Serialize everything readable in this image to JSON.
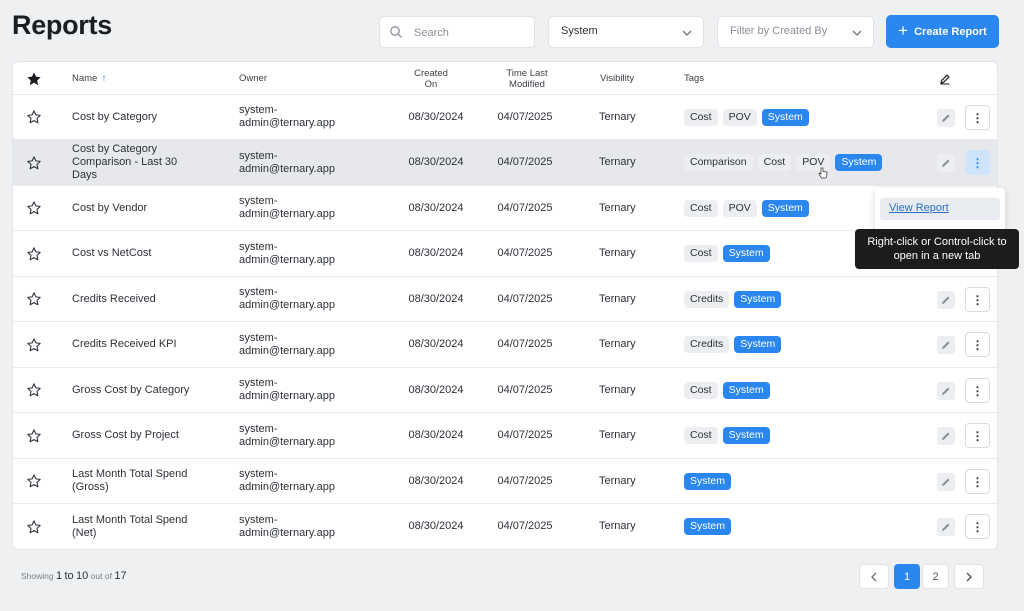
{
  "header": {
    "title": "Reports",
    "search_placeholder": "Search",
    "visibility_filter": "System",
    "created_by_placeholder": "Filter by Created By",
    "create_button": "Create Report"
  },
  "table": {
    "columns": {
      "name": "Name",
      "owner": "Owner",
      "created_line1": "Created",
      "created_line2": "On",
      "modified_line1": "Time Last",
      "modified_line2": "Modified",
      "visibility": "Visibility",
      "tags": "Tags"
    },
    "rows": [
      {
        "name": "Cost by Category",
        "owner1": "system-",
        "owner2": "admin@ternary.app",
        "created": "08/30/2024",
        "modified": "04/07/2025",
        "visibility": "Ternary",
        "tags": [
          "Cost",
          "POV"
        ],
        "system": "System"
      },
      {
        "name": "Cost by Category Comparison - Last 30 Days",
        "owner1": "system-",
        "owner2": "admin@ternary.app",
        "created": "08/30/2024",
        "modified": "04/07/2025",
        "visibility": "Ternary",
        "tags": [
          "Comparison",
          "Cost",
          "POV"
        ],
        "system": "System"
      },
      {
        "name": "Cost by Vendor",
        "owner1": "system-",
        "owner2": "admin@ternary.app",
        "created": "08/30/2024",
        "modified": "04/07/2025",
        "visibility": "Ternary",
        "tags": [
          "Cost",
          "POV"
        ],
        "system": "System"
      },
      {
        "name": "Cost vs NetCost",
        "owner1": "system-",
        "owner2": "admin@ternary.app",
        "created": "08/30/2024",
        "modified": "04/07/2025",
        "visibility": "Ternary",
        "tags": [
          "Cost"
        ],
        "system": "System"
      },
      {
        "name": "Credits Received",
        "owner1": "system-",
        "owner2": "admin@ternary.app",
        "created": "08/30/2024",
        "modified": "04/07/2025",
        "visibility": "Ternary",
        "tags": [
          "Credits"
        ],
        "system": "System"
      },
      {
        "name": "Credits Received KPI",
        "owner1": "system-",
        "owner2": "admin@ternary.app",
        "created": "08/30/2024",
        "modified": "04/07/2025",
        "visibility": "Ternary",
        "tags": [
          "Credits"
        ],
        "system": "System"
      },
      {
        "name": "Gross Cost by Category",
        "owner1": "system-",
        "owner2": "admin@ternary.app",
        "created": "08/30/2024",
        "modified": "04/07/2025",
        "visibility": "Ternary",
        "tags": [
          "Cost"
        ],
        "system": "System"
      },
      {
        "name": "Gross Cost by Project",
        "owner1": "system-",
        "owner2": "admin@ternary.app",
        "created": "08/30/2024",
        "modified": "04/07/2025",
        "visibility": "Ternary",
        "tags": [
          "Cost"
        ],
        "system": "System"
      },
      {
        "name": "Last Month Total Spend (Gross)",
        "owner1": "system-",
        "owner2": "admin@ternary.app",
        "created": "08/30/2024",
        "modified": "04/07/2025",
        "visibility": "Ternary",
        "tags": [],
        "system": "System"
      },
      {
        "name": "Last Month Total Spend (Net)",
        "owner1": "system-",
        "owner2": "admin@ternary.app",
        "created": "08/30/2024",
        "modified": "04/07/2025",
        "visibility": "Ternary",
        "tags": [],
        "system": "System"
      }
    ]
  },
  "context_menu": {
    "view_report": "View Report",
    "tooltip": "Right-click or Control-click to open in a new tab"
  },
  "footer": {
    "showing": "Showing",
    "from": "1",
    "to_word": "to",
    "to": "10",
    "out_of": "out of",
    "total": "17",
    "pages": [
      "1",
      "2"
    ]
  },
  "colors": {
    "accent": "#2a87f0",
    "background": "#eef0f2"
  }
}
